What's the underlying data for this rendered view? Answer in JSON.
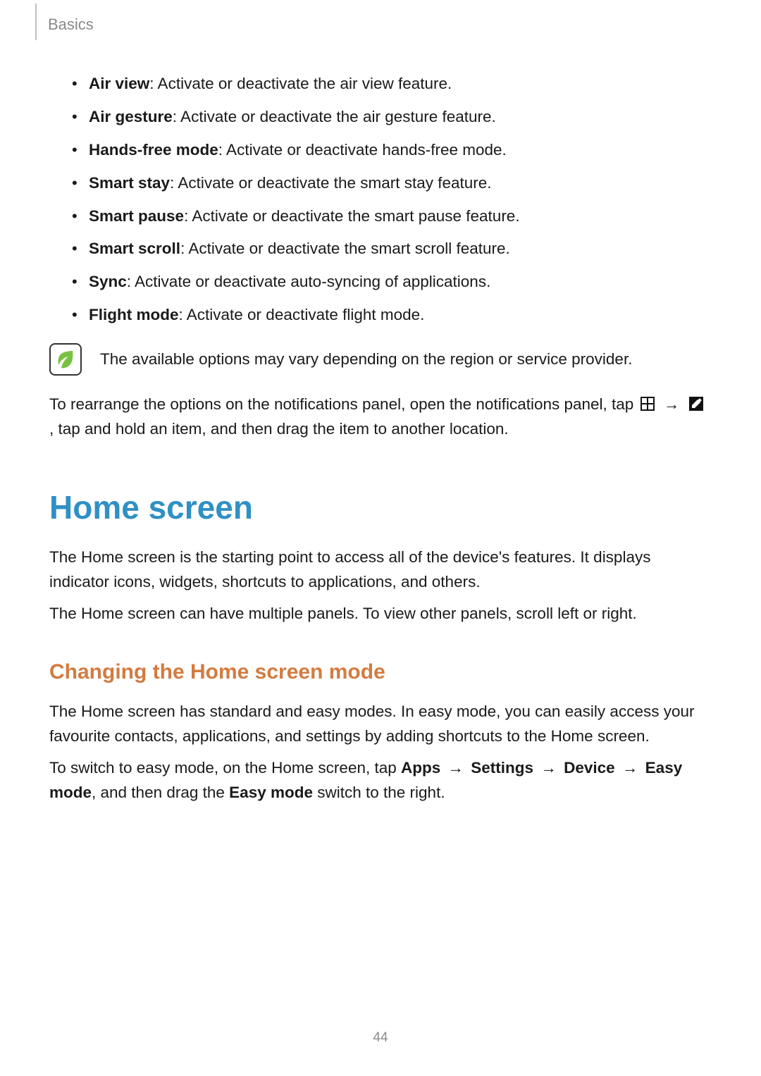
{
  "breadcrumb": "Basics",
  "page_number": "44",
  "feature_list": [
    {
      "term": "Air view",
      "desc": ": Activate or deactivate the air view feature."
    },
    {
      "term": "Air gesture",
      "desc": ": Activate or deactivate the air gesture feature."
    },
    {
      "term": "Hands-free mode",
      "desc": ": Activate or deactivate hands-free mode."
    },
    {
      "term": "Smart stay",
      "desc": ": Activate or deactivate the smart stay feature."
    },
    {
      "term": "Smart pause",
      "desc": ": Activate or deactivate the smart pause feature."
    },
    {
      "term": "Smart scroll",
      "desc": ": Activate or deactivate the smart scroll feature."
    },
    {
      "term": "Sync",
      "desc": ": Activate or deactivate auto-syncing of applications."
    },
    {
      "term": "Flight mode",
      "desc": ": Activate or deactivate flight mode."
    }
  ],
  "note_text": "The available options may vary depending on the region or service provider.",
  "rearrange": {
    "pre": "To rearrange the options on the notifications panel, open the notifications panel, tap ",
    "arrow": "→",
    "post": ", tap and hold an item, and then drag the item to another location."
  },
  "section_heading": "Home screen",
  "home_intro_1": "The Home screen is the starting point to access all of the device's features. It displays indicator icons, widgets, shortcuts to applications, and others.",
  "home_intro_2": "The Home screen can have multiple panels. To view other panels, scroll left or right.",
  "subsection_heading": "Changing the Home screen mode",
  "changing_p1": "The Home screen has standard and easy modes. In easy mode, you can easily access your favourite contacts, applications, and settings by adding shortcuts to the Home screen.",
  "switch_line": {
    "pre": "To switch to easy mode, on the Home screen, tap ",
    "apps": "Apps",
    "settings": "Settings",
    "device": "Device",
    "easy_mode": "Easy mode",
    "arrow": "→",
    "post_pre_easy": ", and then drag the ",
    "easy_mode_bold": "Easy mode",
    "post": " switch to the right."
  }
}
